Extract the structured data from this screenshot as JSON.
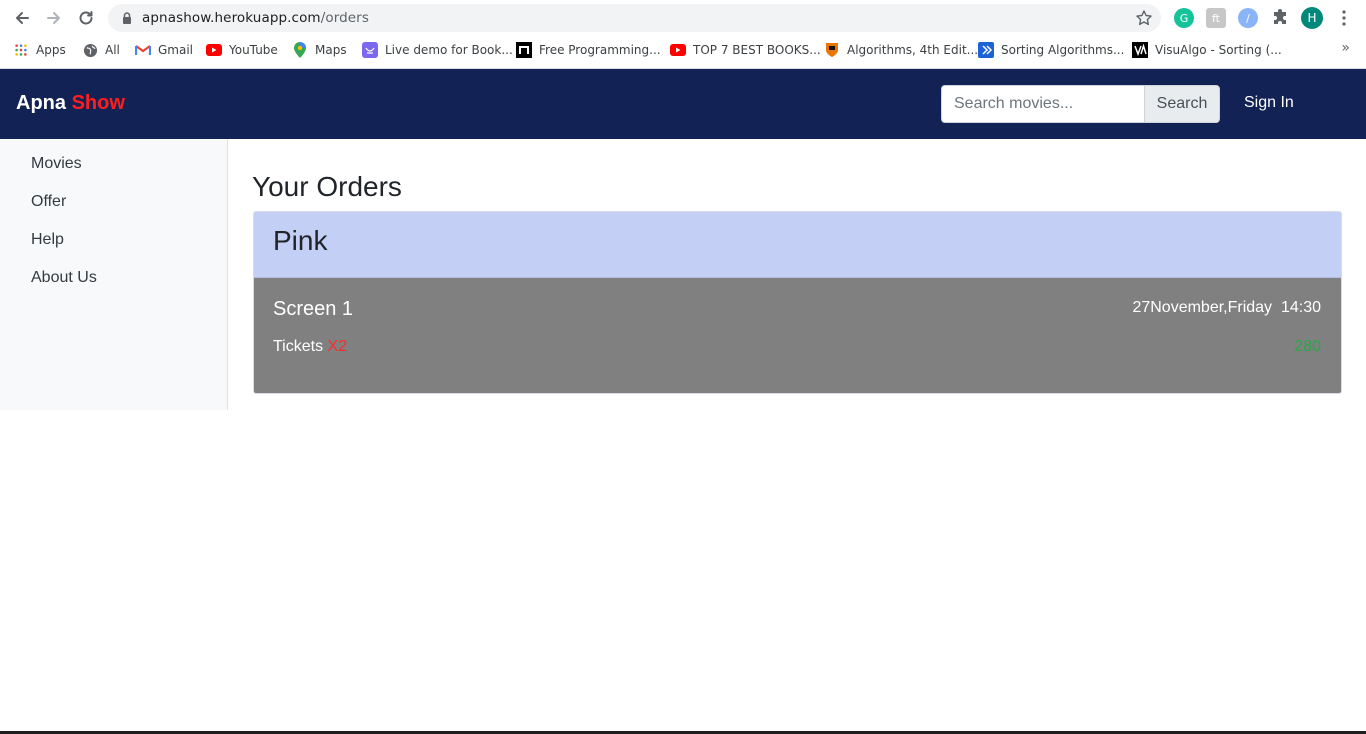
{
  "browser": {
    "url_host": "apnashow.herokuapp.com",
    "url_path": "/orders",
    "profile_initial": "H",
    "bookmarks": [
      {
        "label": "Apps",
        "icon": "apps-grid-icon"
      },
      {
        "label": "All",
        "icon": "globe-icon"
      },
      {
        "label": "Gmail",
        "icon": "gmail-icon"
      },
      {
        "label": "YouTube",
        "icon": "youtube-icon"
      },
      {
        "label": "Maps",
        "icon": "maps-pin-icon"
      },
      {
        "label": "Live demo for Book...",
        "icon": "bookmark-site-icon"
      },
      {
        "label": "Free Programming...",
        "icon": "bookmark-site-icon"
      },
      {
        "label": "TOP 7 BEST BOOKS...",
        "icon": "youtube-icon"
      },
      {
        "label": "Algorithms, 4th Edit...",
        "icon": "princeton-shield-icon"
      },
      {
        "label": "Sorting Algorithms...",
        "icon": "bookmark-site-icon"
      },
      {
        "label": "VisuAlgo - Sorting (...",
        "icon": "visualgo-icon"
      }
    ],
    "more_bookmarks": "»"
  },
  "navbar": {
    "brand_part1": "Apna",
    "brand_part2": "Show",
    "search_placeholder": "Search movies...",
    "search_button": "Search",
    "signin": "Sign In",
    "colors": {
      "background": "#122255",
      "brand_accent": "#ff1e1e"
    }
  },
  "sidebar": {
    "items": [
      {
        "label": "Movies"
      },
      {
        "label": "Offer"
      },
      {
        "label": "Help"
      },
      {
        "label": "About Us"
      }
    ]
  },
  "main": {
    "title": "Your Orders",
    "orders": [
      {
        "movie": "Pink",
        "screen": "Screen 1",
        "date": "27November,Friday",
        "time": "14:30",
        "tickets_label": "Tickets",
        "tickets_qty": "X2",
        "price": "280"
      }
    ]
  }
}
